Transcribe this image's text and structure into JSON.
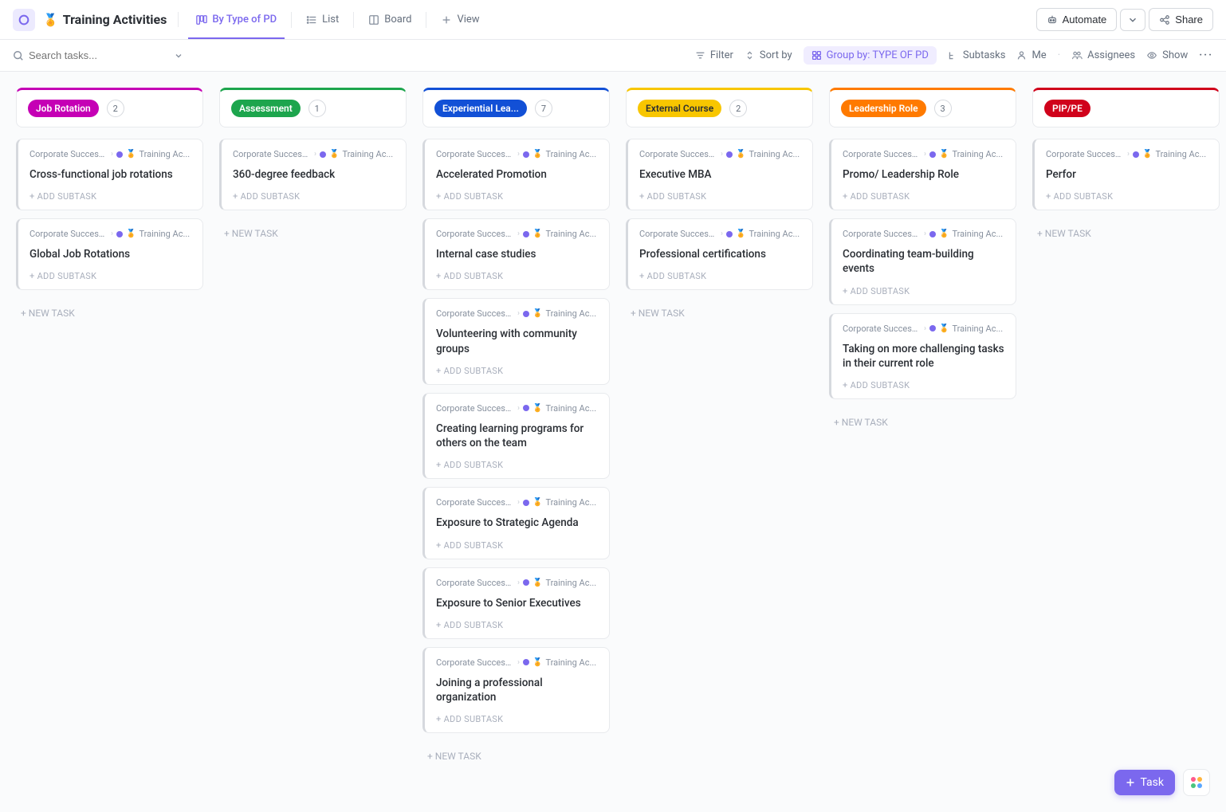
{
  "header": {
    "title": "Training Activities",
    "title_emoji": "🏅",
    "tabs": [
      {
        "id": "by-type",
        "label": "By Type of PD",
        "active": true
      },
      {
        "id": "list",
        "label": "List",
        "active": false
      },
      {
        "id": "board",
        "label": "Board",
        "active": false
      },
      {
        "id": "addview",
        "label": "View",
        "active": false,
        "is_add": true
      }
    ],
    "automate_label": "Automate",
    "share_label": "Share"
  },
  "filterbar": {
    "search_placeholder": "Search tasks...",
    "filter_label": "Filter",
    "sortby_label": "Sort by",
    "groupby_label": "Group by: TYPE OF PD",
    "subtasks_label": "Subtasks",
    "me_label": "Me",
    "assignees_label": "Assignees",
    "show_label": "Show"
  },
  "card_common": {
    "breadcrumb_root": "Corporate Succession ...",
    "breadcrumb_leaf": "Training Ac...",
    "leaf_emoji": "🏅",
    "add_subtask_label": "+ ADD SUBTASK",
    "new_task_label": "+ NEW TASK"
  },
  "columns": [
    {
      "id": "job-rotation",
      "label": "Job Rotation",
      "count": "2",
      "accent": "#c500b5",
      "cards": [
        {
          "title": "Cross-functional job rotations"
        },
        {
          "title": "Global Job Rotations"
        }
      ]
    },
    {
      "id": "assessment",
      "label": "Assessment",
      "count": "1",
      "accent": "#1da54d",
      "cards": [
        {
          "title": "360-degree feedback"
        }
      ]
    },
    {
      "id": "experiential",
      "label": "Experiential Lea...",
      "count": "7",
      "accent": "#1250d6",
      "cards": [
        {
          "title": "Accelerated Promotion"
        },
        {
          "title": "Internal case studies"
        },
        {
          "title": "Volunteering with community groups"
        },
        {
          "title": "Creating learning programs for others on the team"
        },
        {
          "title": "Exposure to Strategic Agenda"
        },
        {
          "title": "Exposure to Senior Executives"
        },
        {
          "title": "Joining a professional organization"
        }
      ]
    },
    {
      "id": "external-course",
      "label": "External Course",
      "count": "2",
      "accent": "#f8c600",
      "label_text_color": "#2a2e34",
      "cards": [
        {
          "title": "Executive MBA"
        },
        {
          "title": "Professional certifications"
        }
      ]
    },
    {
      "id": "leadership-role",
      "label": "Leadership Role",
      "count": "3",
      "accent": "#ff7a00",
      "cards": [
        {
          "title": "Promo/ Leadership Role"
        },
        {
          "title": "Coordinating team-building events"
        },
        {
          "title": "Taking on more challenging tasks in their current role"
        }
      ]
    },
    {
      "id": "pip",
      "label": "PIP/PE",
      "count": "",
      "accent": "#d0021b",
      "truncated": true,
      "cards": [
        {
          "title": "Perfor"
        }
      ]
    }
  ],
  "fab": {
    "task_label": "Task"
  }
}
